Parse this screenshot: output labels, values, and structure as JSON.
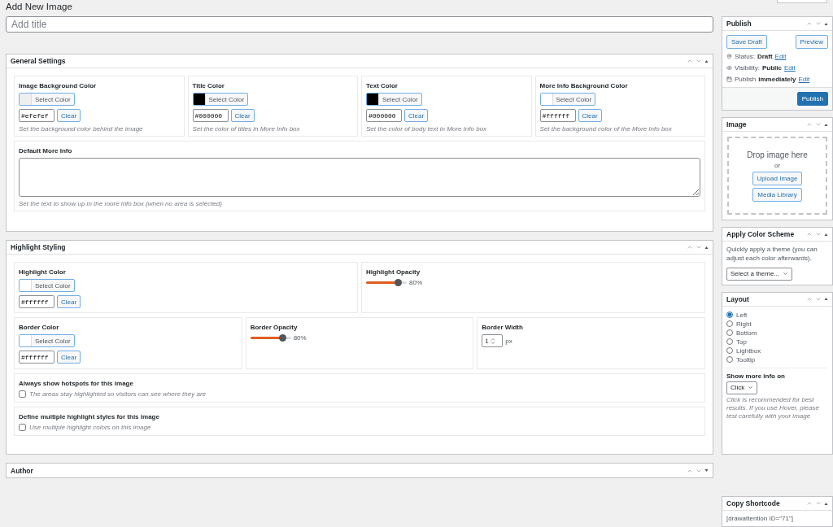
{
  "page_title": "Add New Image",
  "title_field": {
    "placeholder": "Add title"
  },
  "general_settings": {
    "title": "General Settings",
    "expanded": true,
    "color_fields": [
      {
        "label": "Image Background Color",
        "color": "#efefef",
        "select_label": "Select Color",
        "value": "#efefef",
        "clear_label": "Clear",
        "description": "Set the background color behind the image"
      },
      {
        "label": "Title Color",
        "color": "#000000",
        "select_label": "Select Color",
        "value": "#000000",
        "clear_label": "Clear",
        "description": "Set the color of titles in More Info box"
      },
      {
        "label": "Text Color",
        "color": "#000000",
        "select_label": "Select Color",
        "value": "#000000",
        "clear_label": "Clear",
        "description": "Set the color of body text in More Info box"
      },
      {
        "label": "More Info Background Color",
        "color": "#ffffff",
        "select_label": "Select Color",
        "value": "#ffffff",
        "clear_label": "Clear",
        "description": "Set the background color of the More Info box"
      }
    ],
    "more_info": {
      "label": "Default More Info",
      "description": "Set the text to show up in the more info box (when no area is selected)"
    }
  },
  "highlight_styling": {
    "title": "Highlight Styling",
    "expanded": true,
    "highlight_color": {
      "label": "Highlight Color",
      "color": "#ffffff",
      "select_label": "Select Color",
      "value": "#ffffff",
      "clear_label": "Clear"
    },
    "highlight_opacity": {
      "label": "Highlight Opacity",
      "level": 0.8,
      "reading": "80%"
    },
    "border_color": {
      "label": "Border Color",
      "color": "#ffffff",
      "select_label": "Select Color",
      "value": "#ffffff",
      "clear_label": "Clear"
    },
    "border_opacity": {
      "label": "Border Opacity",
      "level": 0.8,
      "reading": "80%"
    },
    "border_width": {
      "label": "Border Width",
      "value": "1",
      "unit": "px"
    },
    "options": [
      {
        "title": "Always show hotspots for this image",
        "label": "The areas stay highlighted so visitors can see where they are",
        "checked": false
      },
      {
        "title": "Define multiple highlight styles for this image",
        "label": "Use multiple highlight colors on this image",
        "checked": false
      }
    ]
  },
  "author": {
    "title": "Author",
    "expanded": false
  },
  "publish": {
    "title": "Publish",
    "expanded": true,
    "save_draft": "Save Draft",
    "preview": "Preview",
    "rows": [
      {
        "kind": "status",
        "label": "Status:",
        "value": "Draft",
        "link": "Edit"
      },
      {
        "kind": "visibility",
        "label": "Visibility:",
        "value": "Public",
        "link": "Edit"
      },
      {
        "kind": "schedule",
        "label": "Publish",
        "value": "immediately",
        "link": "Edit"
      }
    ],
    "publish_button": "Publish"
  },
  "image": {
    "title": "Image",
    "expanded": true,
    "drop_text": "Drop image here",
    "or": "or",
    "upload": "Upload Image",
    "media": "Media Library"
  },
  "color_scheme": {
    "title": "Apply Color Scheme",
    "expanded": true,
    "description": "Quickly apply a theme (you can adjust each color afterwards).",
    "select": "Select a theme..."
  },
  "layout": {
    "title": "Layout",
    "expanded": true,
    "options": [
      {
        "label": "Left",
        "selected": true
      },
      {
        "label": "Right",
        "selected": false
      },
      {
        "label": "Bottom",
        "selected": false
      },
      {
        "label": "Top",
        "selected": false
      },
      {
        "label": "Lightbox",
        "selected": false
      },
      {
        "label": "Tooltip",
        "selected": false
      }
    ],
    "show_more_title": "Show more info on",
    "show_more_select": "Click",
    "note": "Click is recommended for best results. If you use Hover, please test carefully with your image"
  },
  "shortcode": {
    "title": "Copy Shortcode",
    "expanded": true,
    "text": "[drawattention ID=\"71\"]"
  }
}
